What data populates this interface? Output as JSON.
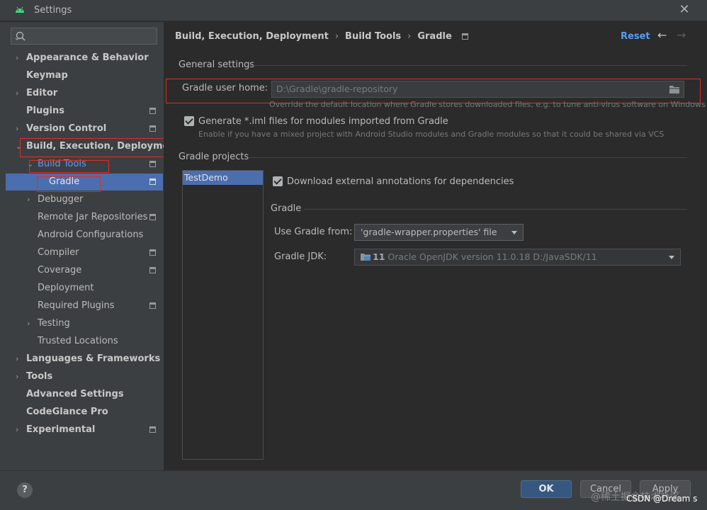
{
  "window": {
    "title": "Settings",
    "close_icon": "close-icon"
  },
  "colors": {
    "accent": "#4b6eaf",
    "link": "#589df6",
    "annotation": "#e02b2b",
    "primary_button": "#365880"
  },
  "search": {
    "placeholder": ""
  },
  "sidebar": {
    "items": [
      {
        "label": "Appearance & Behavior"
      },
      {
        "label": "Keymap"
      },
      {
        "label": "Editor"
      },
      {
        "label": "Plugins"
      },
      {
        "label": "Version Control"
      },
      {
        "label": "Build, Execution, Deployment"
      },
      {
        "label": "Build Tools"
      },
      {
        "label": "Gradle"
      },
      {
        "label": "Debugger"
      },
      {
        "label": "Remote Jar Repositories"
      },
      {
        "label": "Android Configurations"
      },
      {
        "label": "Compiler"
      },
      {
        "label": "Coverage"
      },
      {
        "label": "Deployment"
      },
      {
        "label": "Required Plugins"
      },
      {
        "label": "Testing"
      },
      {
        "label": "Trusted Locations"
      },
      {
        "label": "Languages & Frameworks"
      },
      {
        "label": "Tools"
      },
      {
        "label": "Advanced Settings"
      },
      {
        "label": "CodeGlance Pro"
      },
      {
        "label": "Experimental"
      }
    ]
  },
  "header": {
    "breadcrumb": [
      "Build, Execution, Deployment",
      "Build Tools",
      "Gradle"
    ],
    "separator": "›",
    "reset_label": "Reset"
  },
  "general": {
    "title": "General settings",
    "user_home_label": "Gradle user home:",
    "user_home_value": "D:\\Gradle\\gradle-repository",
    "user_home_hint": "Override the default location where Gradle stores downloaded files, e.g. to tune anti-virus software on Windows",
    "generate_iml_label": "Generate *.iml files for modules imported from Gradle",
    "generate_iml_hint": "Enable if you have a mixed project with Android Studio modules and Gradle modules so that it could be shared via VCS",
    "generate_iml_checked": true
  },
  "projects": {
    "title": "Gradle projects",
    "list": [
      "TestDemo"
    ],
    "download_annotations_label": "Download external annotations for dependencies",
    "download_annotations_checked": true,
    "gradle_section_title": "Gradle",
    "use_gradle_from_label": "Use Gradle from:",
    "use_gradle_from_value": "'gradle-wrapper.properties' file",
    "gradle_jdk_label": "Gradle JDK:",
    "gradle_jdk_version": "11",
    "gradle_jdk_value": "Oracle OpenJDK version 11.0.18 D:/JavaSDK/11"
  },
  "footer": {
    "help_label": "?",
    "ok_label": "OK",
    "cancel_label": "Cancel",
    "apply_label": "Apply"
  },
  "watermark": {
    "text": "@稀土掘金技术社区",
    "text2": "CSDN @Dream s"
  }
}
